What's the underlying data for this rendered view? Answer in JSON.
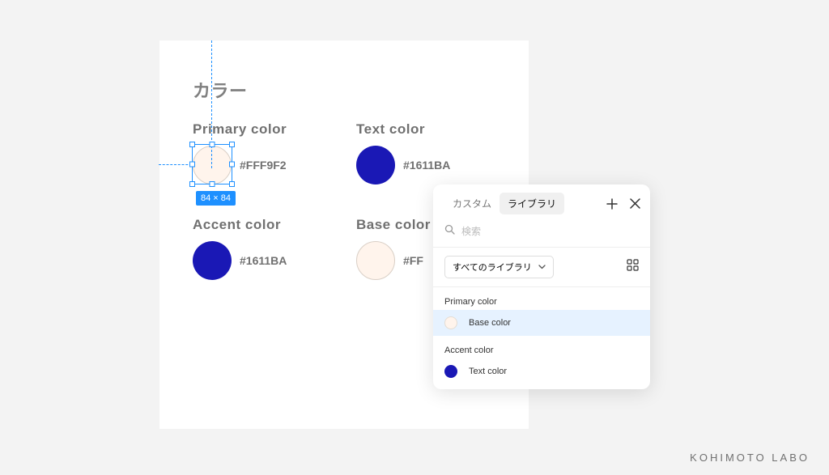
{
  "section_title": "カラー",
  "swatches": {
    "primary": {
      "label": "Primary color",
      "hex": "#FFF9F2",
      "color": "#FFF4EC",
      "stroke": "#d9cfc6"
    },
    "text": {
      "label": "Text color",
      "hex": "#1611BA",
      "color": "#1A18B5"
    },
    "accent": {
      "label": "Accent color",
      "hex": "#1611BA",
      "color": "#1A18B5"
    },
    "base": {
      "label": "Base color",
      "hex": "#FF",
      "color": "#FFF4EC",
      "stroke": "#d9cfc6"
    }
  },
  "selection_size": "84 × 84",
  "panel": {
    "tab_custom": "カスタム",
    "tab_library": "ライブラリ",
    "search_placeholder": "検索",
    "dropdown_label": "すべてのライブラリ",
    "sections": [
      {
        "title": "Primary color",
        "item": {
          "label": "Base color",
          "color": "#FFF4EC",
          "stroke": "#e4dcd3",
          "selected": true
        }
      },
      {
        "title": "Accent color",
        "item": {
          "label": "Text color",
          "color": "#1A18B5",
          "selected": false
        }
      }
    ]
  },
  "watermark": "KOHIMOTO LABO"
}
